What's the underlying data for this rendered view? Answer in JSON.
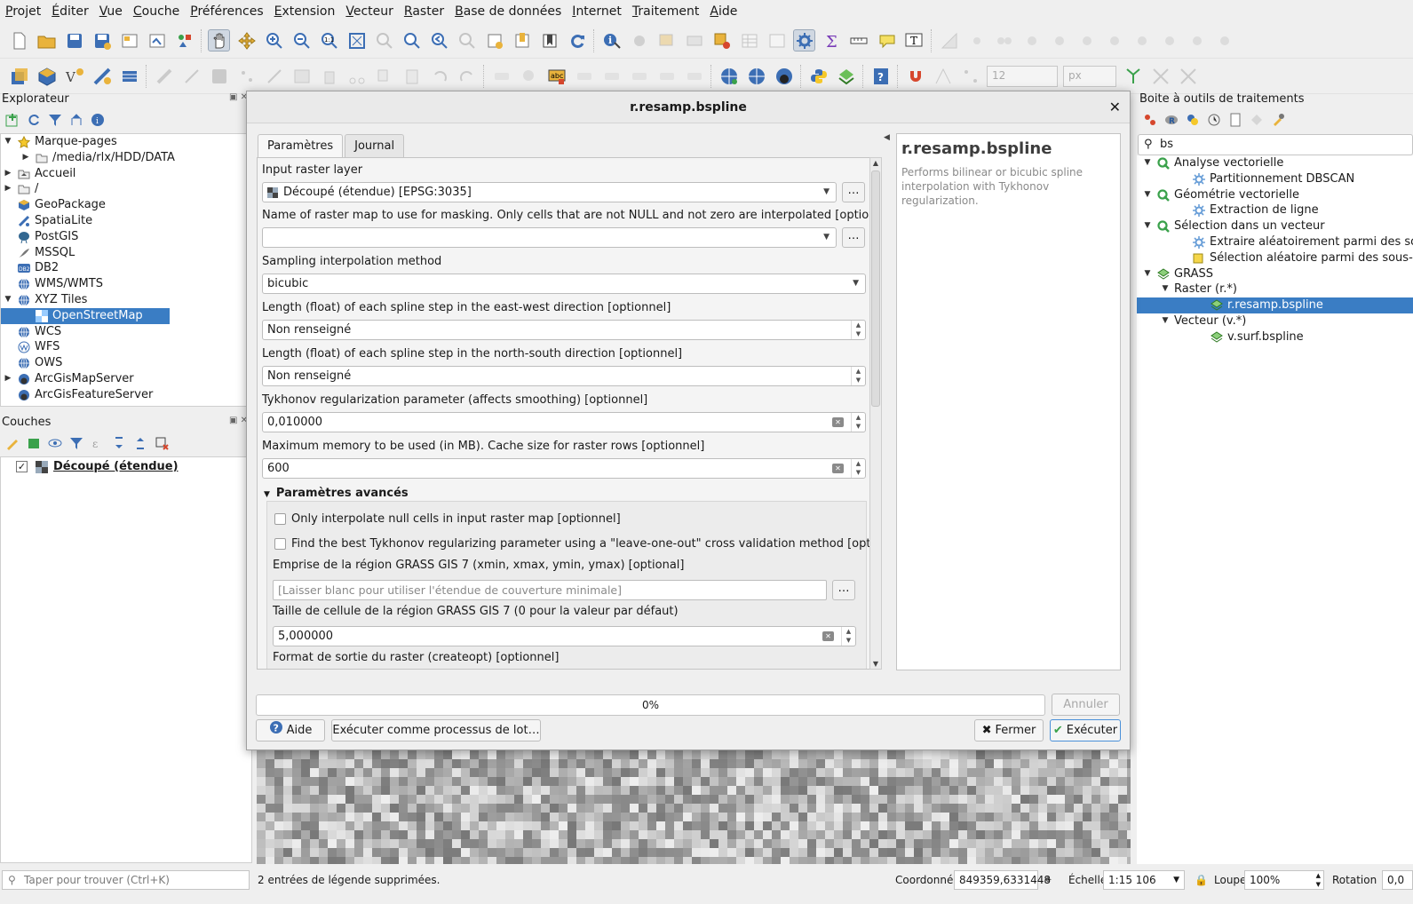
{
  "menu": [
    "Projet",
    "Éditer",
    "Vue",
    "Couche",
    "Préférences",
    "Extension",
    "Vecteur",
    "Raster",
    "Base de données",
    "Internet",
    "Traitement",
    "Aide"
  ],
  "toolbar2": {
    "size_value": "12",
    "unit_value": "px"
  },
  "browser": {
    "title": "Explorateur",
    "items": [
      {
        "label": "Marque-pages",
        "icon": "star-icon",
        "arrow": "▼",
        "indent": 0
      },
      {
        "label": "/media/rlx/HDD/DATA",
        "icon": "folder-icon",
        "arrow": "▶",
        "indent": 1
      },
      {
        "label": "Accueil",
        "icon": "home-folder-icon",
        "arrow": "▶",
        "indent": 0
      },
      {
        "label": "/",
        "icon": "folder-icon",
        "arrow": "▶",
        "indent": 0
      },
      {
        "label": "GeoPackage",
        "icon": "geopackage-icon",
        "arrow": "",
        "indent": 0
      },
      {
        "label": "SpatiaLite",
        "icon": "spatialite-icon",
        "arrow": "",
        "indent": 0
      },
      {
        "label": "PostGIS",
        "icon": "postgis-icon",
        "arrow": "",
        "indent": 0
      },
      {
        "label": "MSSQL",
        "icon": "mssql-icon",
        "arrow": "",
        "indent": 0
      },
      {
        "label": "DB2",
        "icon": "db2-icon",
        "arrow": "",
        "indent": 0
      },
      {
        "label": "WMS/WMTS",
        "icon": "globe-icon",
        "arrow": "",
        "indent": 0
      },
      {
        "label": "XYZ Tiles",
        "icon": "globe-icon",
        "arrow": "▼",
        "indent": 0
      },
      {
        "label": "OpenStreetMap",
        "icon": "xyz-tile-icon",
        "arrow": "",
        "indent": 1,
        "selected": true
      },
      {
        "label": "WCS",
        "icon": "globe-icon",
        "arrow": "",
        "indent": 0
      },
      {
        "label": "WFS",
        "icon": "wfs-icon",
        "arrow": "",
        "indent": 0
      },
      {
        "label": "OWS",
        "icon": "globe-icon",
        "arrow": "",
        "indent": 0
      },
      {
        "label": "ArcGisMapServer",
        "icon": "arcgis-icon",
        "arrow": "▶",
        "indent": 0
      },
      {
        "label": "ArcGisFeatureServer",
        "icon": "arcgis-icon",
        "arrow": "",
        "indent": 0
      }
    ]
  },
  "layers": {
    "title": "Couches",
    "items": [
      {
        "label": "Découpé (étendue)",
        "checked": true
      }
    ]
  },
  "dialog": {
    "title": "r.resamp.bspline",
    "tabs": [
      "Paramètres",
      "Journal"
    ],
    "input_raster_label": "Input raster layer",
    "input_raster_value": "Découpé (étendue) [EPSG:3035]",
    "mask_label": "Name of raster map to use for masking. Only cells that are not NULL and not zero are interpolated [optional]",
    "mask_value": "",
    "method_label": "Sampling interpolation method",
    "method_value": "bicubic",
    "ew_label": "Length (float) of each spline step in the east-west direction [optionnel]",
    "ew_value": "Non renseigné",
    "ns_label": "Length (float) of each spline step in the north-south direction [optionnel]",
    "ns_value": "Non renseigné",
    "lambda_label": "Tykhonov regularization parameter (affects smoothing) [optionnel]",
    "lambda_value": "0,010000",
    "memory_label": "Maximum memory to be used (in MB). Cache size for raster rows [optionnel]",
    "memory_value": "600",
    "advanced_label": "Paramètres avancés",
    "null_only_label": "Only interpolate null cells in input raster map [optionnel]",
    "cv_label": "Find the best Tykhonov regularizing parameter using a \"leave-one-out\" cross validation method [optionnel]",
    "region_label": "Emprise de la région GRASS GIS 7 (xmin, xmax, ymin, ymax) [optional]",
    "region_placeholder": "[Laisser blanc pour utiliser l'étendue de couverture minimale]",
    "cellsize_label": "Taille de cellule de la région GRASS GIS 7 (0 pour la valeur par défaut)",
    "cellsize_value": "5,000000",
    "createopt_label": "Format de sortie du raster (createopt) [optionnel]",
    "help_title": "r.resamp.bspline",
    "help_text": "Performs bilinear or bicubic spline interpolation with Tykhonov regularization.",
    "progress_text": "0%",
    "cancel_label": "Annuler",
    "help_button": "Aide",
    "batch_button": "Exécuter comme processus de lot…",
    "close_button": "Fermer",
    "run_button": "Exécuter",
    "ellipsis": "…"
  },
  "toolbox": {
    "title": "Boite à outils de traitements",
    "search_value": "bs",
    "items": [
      {
        "label": "Analyse vectorielle",
        "icon": "qgis-q-icon",
        "arrow": "▼",
        "indent": 0
      },
      {
        "label": "Partitionnement DBSCAN",
        "icon": "gear-icon",
        "arrow": "",
        "indent": 2
      },
      {
        "label": "Géométrie vectorielle",
        "icon": "qgis-q-icon",
        "arrow": "▼",
        "indent": 0
      },
      {
        "label": "Extraction de ligne",
        "icon": "gear-icon",
        "arrow": "",
        "indent": 2
      },
      {
        "label": "Sélection dans un vecteur",
        "icon": "qgis-q-icon",
        "arrow": "▼",
        "indent": 0
      },
      {
        "label": "Extraire aléatoirement parmi des sous-",
        "icon": "gear-icon",
        "arrow": "",
        "indent": 2
      },
      {
        "label": "Sélection aléatoire parmi des sous-ense",
        "icon": "select-icon",
        "arrow": "",
        "indent": 2
      },
      {
        "label": "GRASS",
        "icon": "grass-icon",
        "arrow": "▼",
        "indent": 0
      },
      {
        "label": "Raster (r.*)",
        "icon": "",
        "arrow": "▼",
        "indent": 1
      },
      {
        "label": "r.resamp.bspline",
        "icon": "grass-icon",
        "arrow": "",
        "indent": 3,
        "selected": true
      },
      {
        "label": "Vecteur (v.*)",
        "icon": "",
        "arrow": "▼",
        "indent": 1
      },
      {
        "label": "v.surf.bspline",
        "icon": "grass-icon",
        "arrow": "",
        "indent": 3
      }
    ]
  },
  "statusbar": {
    "search_placeholder": "Taper pour trouver (Ctrl+K)",
    "message": "2 entrées de légende supprimées.",
    "coord_label": "Coordonnée",
    "coord_value": "849359,6331448",
    "scale_label": "Échelle",
    "scale_value": "1:15 106",
    "magnifier_label": "Loupe",
    "magnifier_value": "100%",
    "rotation_label": "Rotation",
    "rotation_value": "0,0"
  }
}
